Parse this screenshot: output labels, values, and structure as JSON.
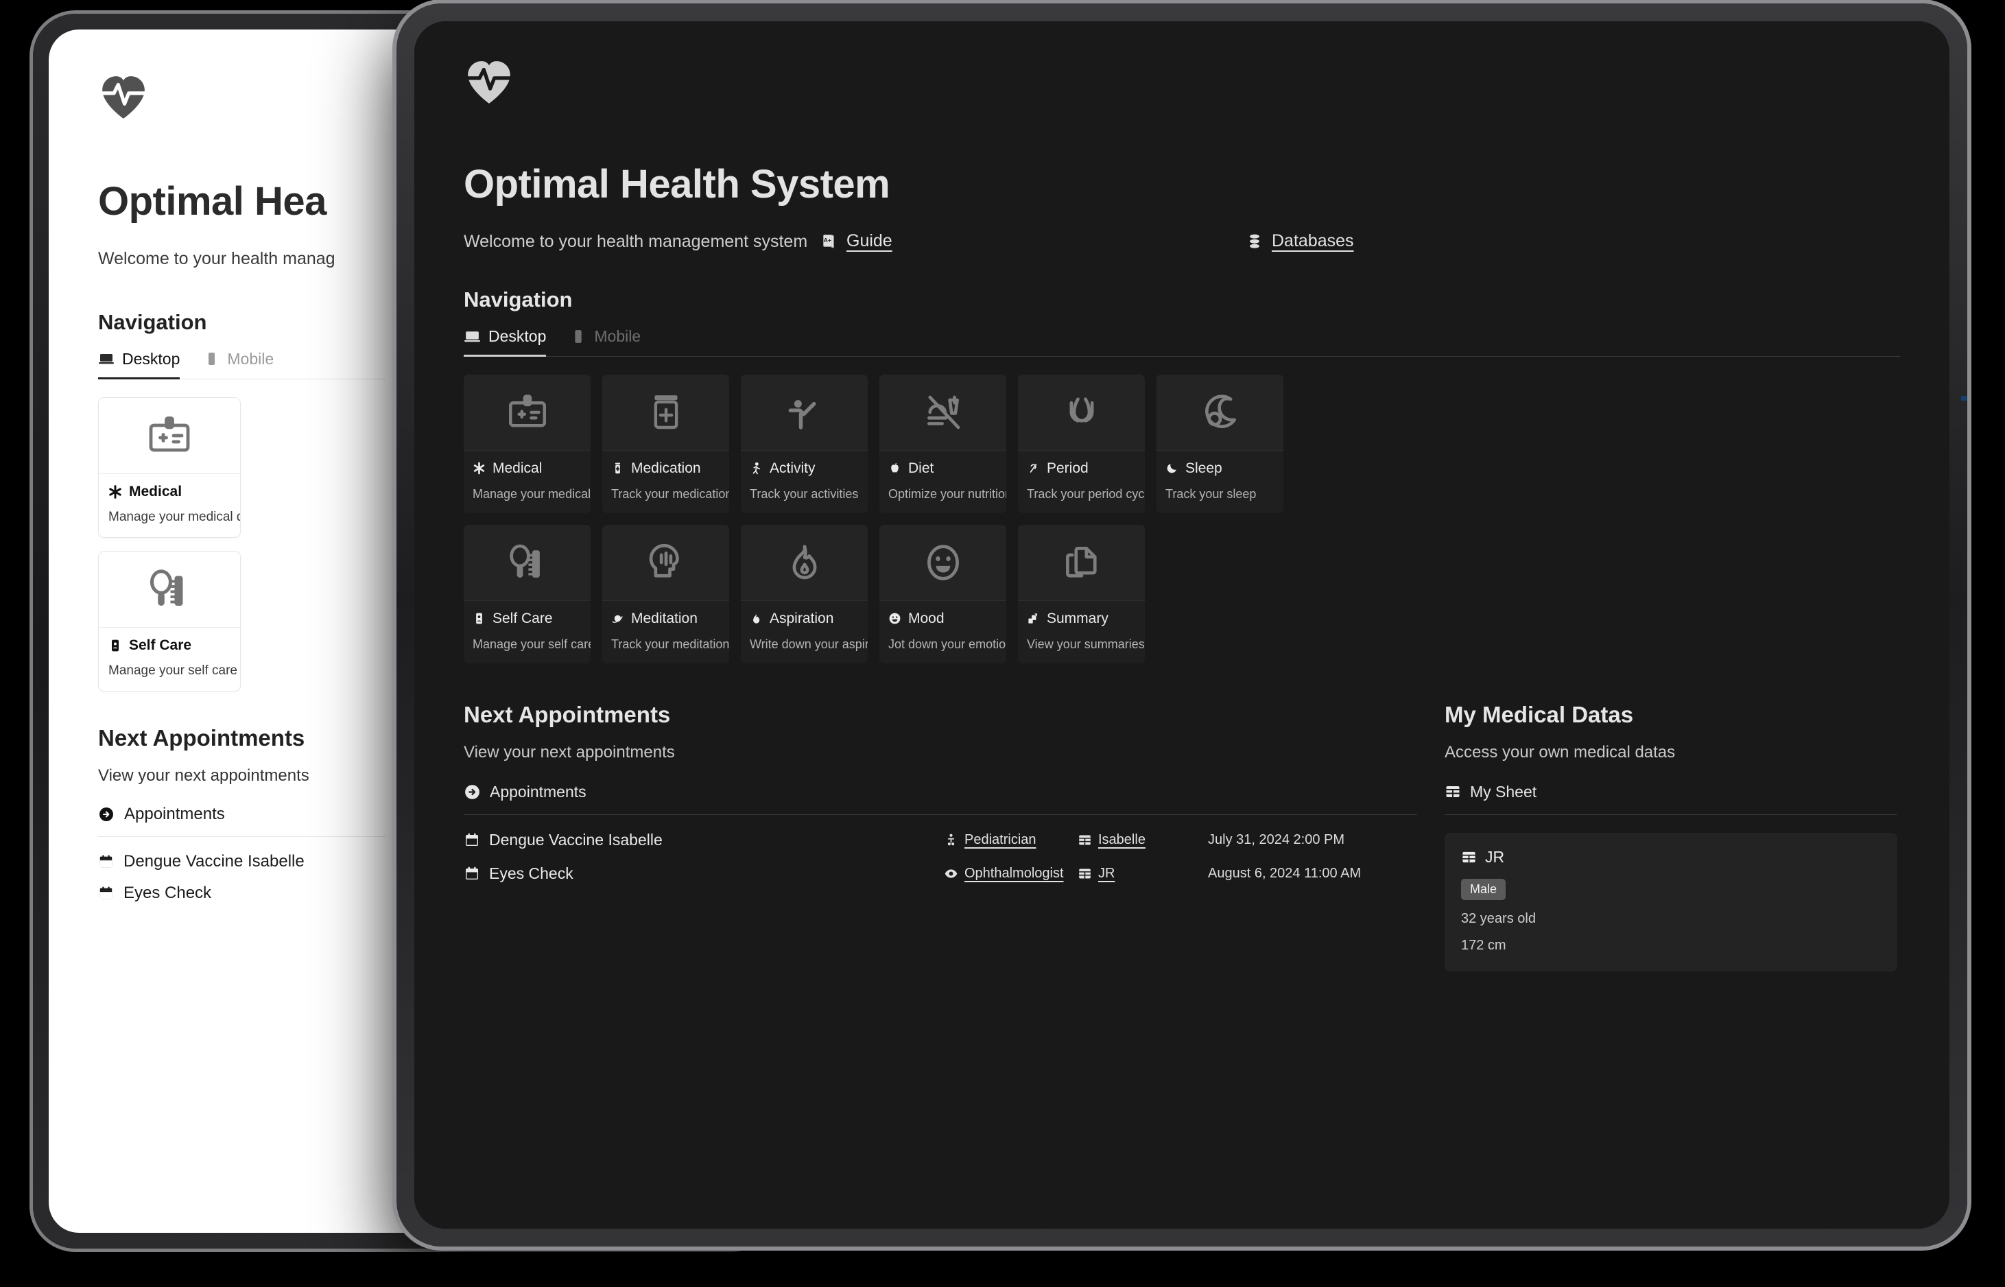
{
  "app": {
    "title": "Optimal Health System",
    "subtitle": "Welcome to your health management system",
    "logo_icon": "heart-pulse-icon",
    "colors": {
      "dark_bg": "#191919",
      "dark_card": "#1f1f1f",
      "dark_card_art": "#242424",
      "light_bg": "#ffffff",
      "accent_text": "#e3e3e3",
      "muted_text": "#b4b4b4",
      "badge_bg": "#5a5a5a"
    }
  },
  "top_links": [
    {
      "label": "Guide",
      "icon": "book-a-plus-icon"
    },
    {
      "label": "Databases",
      "icon": "database-stack-icon"
    }
  ],
  "navigation": {
    "heading": "Navigation",
    "tabs": [
      {
        "label": "Desktop",
        "icon": "laptop-icon",
        "active": true
      },
      {
        "label": "Mobile",
        "icon": "phone-icon",
        "active": false
      }
    ],
    "row1": [
      {
        "title": "Medical",
        "desc": "Manage your medical datas",
        "art_icon": "id-badge-medical-icon",
        "title_icon": "asterisk-medical-icon"
      },
      {
        "title": "Medication",
        "desc": "Track your medication",
        "art_icon": "pill-bottle-icon",
        "title_icon": "pill-bottle-small-icon"
      },
      {
        "title": "Activity",
        "desc": "Track your activities",
        "art_icon": "martial-arts-icon",
        "title_icon": "running-person-icon"
      },
      {
        "title": "Diet",
        "desc": "Optimize your nutrition",
        "art_icon": "no-fast-food-icon",
        "title_icon": "apple-icon"
      },
      {
        "title": "Period",
        "desc": "Track your period cycles",
        "art_icon": "tulip-flower-icon",
        "title_icon": "ribbon-icon"
      },
      {
        "title": "Sleep",
        "desc": "Track your sleep",
        "art_icon": "moon-cloud-icon",
        "title_icon": "crescent-moon-icon"
      }
    ],
    "row2": [
      {
        "title": "Self Care",
        "desc": "Manage your self care routine",
        "art_icon": "mirror-comb-icon",
        "title_icon": "id-card-icon"
      },
      {
        "title": "Meditation",
        "desc": "Track your meditation sessions",
        "art_icon": "mindful-head-icon",
        "title_icon": "planet-icon"
      },
      {
        "title": "Aspiration",
        "desc": "Write down your aspirations",
        "art_icon": "flame-icon",
        "title_icon": "flame-small-icon"
      },
      {
        "title": "Mood",
        "desc": "Jot down your emotions",
        "art_icon": "smiley-face-icon",
        "title_icon": "smiley-small-icon"
      },
      {
        "title": "Summary",
        "desc": "View your summaries",
        "art_icon": "document-copy-icon",
        "title_icon": "documents-small-icon"
      }
    ]
  },
  "appointments": {
    "heading": "Next Appointments",
    "subtitle": "View your next appointments",
    "link_label": "Appointments",
    "link_icon": "arrow-right-circle-icon",
    "rows": [
      {
        "name": "Dengue Vaccine Isabelle",
        "name_icon": "calendar-icon",
        "specialty": "Pediatrician",
        "specialty_icon": "baby-icon",
        "person": "Isabelle",
        "person_icon": "table-icon",
        "datetime": "July 31, 2024 2:00 PM"
      },
      {
        "name": "Eyes Check",
        "name_icon": "calendar-icon",
        "specialty": "Ophthalmologist",
        "specialty_icon": "eye-icon",
        "person": "JR",
        "person_icon": "table-icon",
        "datetime": "August 6, 2024 11:00 AM"
      }
    ]
  },
  "medical_datas": {
    "heading": "My Medical Datas",
    "subtitle": "Access your own medical datas",
    "link_label": "My Sheet",
    "link_icon": "table-icon",
    "record": {
      "name": "JR",
      "name_icon": "table-icon",
      "gender": "Male",
      "age": "32 years old",
      "height": "172 cm"
    }
  },
  "back_device": {
    "title": "Optimal Hea",
    "subtitle": "Welcome to your health manag",
    "navigation_heading": "Navigation",
    "cards": [
      {
        "title": "Medical",
        "desc": "Manage your medical datas",
        "art_icon": "id-badge-medical-icon",
        "title_icon": "asterisk-medical-icon"
      },
      {
        "title": "Self Care",
        "desc": "Manage your self care routine",
        "art_icon": "mirror-comb-icon",
        "title_icon": "id-card-icon"
      }
    ],
    "appointments_heading": "Next Appointments",
    "appointments_subtitle": "View your next appointments",
    "appointments_link": "Appointments",
    "appointment_rows": [
      {
        "name": "Dengue Vaccine Isabelle"
      },
      {
        "name": "Eyes Check"
      }
    ]
  }
}
